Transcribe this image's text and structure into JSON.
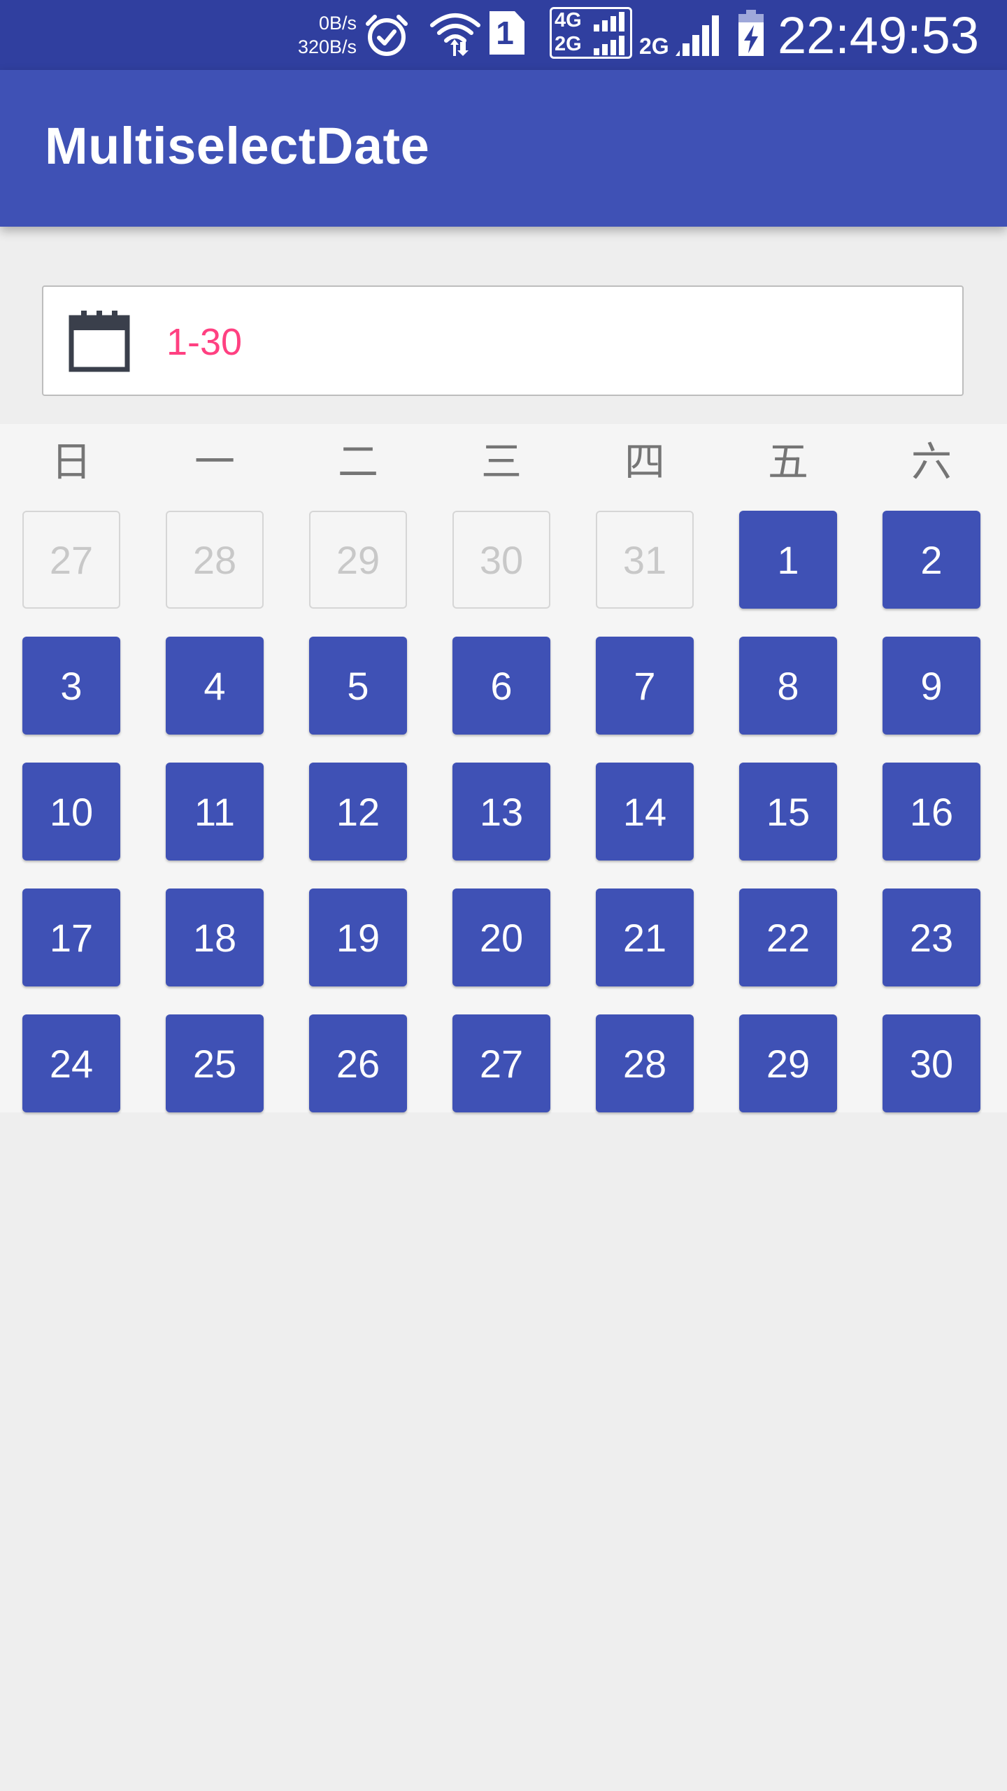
{
  "status_bar": {
    "net_down": "0B/s",
    "net_up": "320B/s",
    "sim_slot": "1",
    "network_4g": "4G",
    "network_2g_a": "2G",
    "network_2g_b": "2G",
    "time": "22:49:53",
    "icons": [
      "alarm-icon",
      "wifi-icon",
      "sim-icon",
      "signal-icon",
      "battery-charging-icon"
    ]
  },
  "app_bar": {
    "title": "MultiselectDate"
  },
  "date_field": {
    "icon": "calendar-icon",
    "value": "1-30"
  },
  "calendar": {
    "weekdays": [
      "日",
      "一",
      "二",
      "三",
      "四",
      "五",
      "六"
    ],
    "weeks": [
      [
        {
          "label": "27",
          "in_month": false,
          "selected": false
        },
        {
          "label": "28",
          "in_month": false,
          "selected": false
        },
        {
          "label": "29",
          "in_month": false,
          "selected": false
        },
        {
          "label": "30",
          "in_month": false,
          "selected": false
        },
        {
          "label": "31",
          "in_month": false,
          "selected": false
        },
        {
          "label": "1",
          "in_month": true,
          "selected": true
        },
        {
          "label": "2",
          "in_month": true,
          "selected": true
        }
      ],
      [
        {
          "label": "3",
          "in_month": true,
          "selected": true
        },
        {
          "label": "4",
          "in_month": true,
          "selected": true
        },
        {
          "label": "5",
          "in_month": true,
          "selected": true
        },
        {
          "label": "6",
          "in_month": true,
          "selected": true
        },
        {
          "label": "7",
          "in_month": true,
          "selected": true
        },
        {
          "label": "8",
          "in_month": true,
          "selected": true
        },
        {
          "label": "9",
          "in_month": true,
          "selected": true
        }
      ],
      [
        {
          "label": "10",
          "in_month": true,
          "selected": true
        },
        {
          "label": "11",
          "in_month": true,
          "selected": true
        },
        {
          "label": "12",
          "in_month": true,
          "selected": true
        },
        {
          "label": "13",
          "in_month": true,
          "selected": true
        },
        {
          "label": "14",
          "in_month": true,
          "selected": true
        },
        {
          "label": "15",
          "in_month": true,
          "selected": true
        },
        {
          "label": "16",
          "in_month": true,
          "selected": true
        }
      ],
      [
        {
          "label": "17",
          "in_month": true,
          "selected": true
        },
        {
          "label": "18",
          "in_month": true,
          "selected": true
        },
        {
          "label": "19",
          "in_month": true,
          "selected": true
        },
        {
          "label": "20",
          "in_month": true,
          "selected": true
        },
        {
          "label": "21",
          "in_month": true,
          "selected": true
        },
        {
          "label": "22",
          "in_month": true,
          "selected": true
        },
        {
          "label": "23",
          "in_month": true,
          "selected": true
        }
      ],
      [
        {
          "label": "24",
          "in_month": true,
          "selected": true
        },
        {
          "label": "25",
          "in_month": true,
          "selected": true
        },
        {
          "label": "26",
          "in_month": true,
          "selected": true
        },
        {
          "label": "27",
          "in_month": true,
          "selected": true
        },
        {
          "label": "28",
          "in_month": true,
          "selected": true
        },
        {
          "label": "29",
          "in_month": true,
          "selected": true
        },
        {
          "label": "30",
          "in_month": true,
          "selected": true
        }
      ]
    ]
  },
  "colors": {
    "status_bar": "#303f9f",
    "primary": "#3f51b5",
    "accent": "#ff4081",
    "background": "#eeeeee"
  }
}
